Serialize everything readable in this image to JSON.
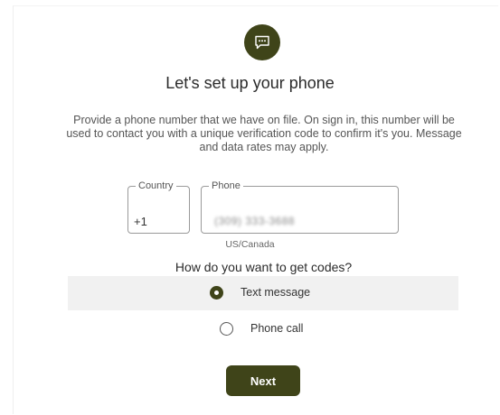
{
  "header": {
    "icon": "chat-message-icon",
    "title": "Let's set up your phone"
  },
  "description": "Provide a phone number that we have on file. On sign in, this number will be used to contact you with a unique verification code to confirm it's you. Message and data rates may apply.",
  "form": {
    "country": {
      "label": "Country",
      "value": "+1"
    },
    "phone": {
      "label": "Phone",
      "value": "(309) 333-3688"
    },
    "region_hint": "US/Canada"
  },
  "delivery": {
    "question": "How do you want to get codes?",
    "options": [
      {
        "label": "Text message",
        "selected": true
      },
      {
        "label": "Phone call",
        "selected": false
      }
    ]
  },
  "actions": {
    "next_label": "Next"
  },
  "colors": {
    "accent": "#3f4419",
    "selected_row": "#f1f1f1"
  }
}
